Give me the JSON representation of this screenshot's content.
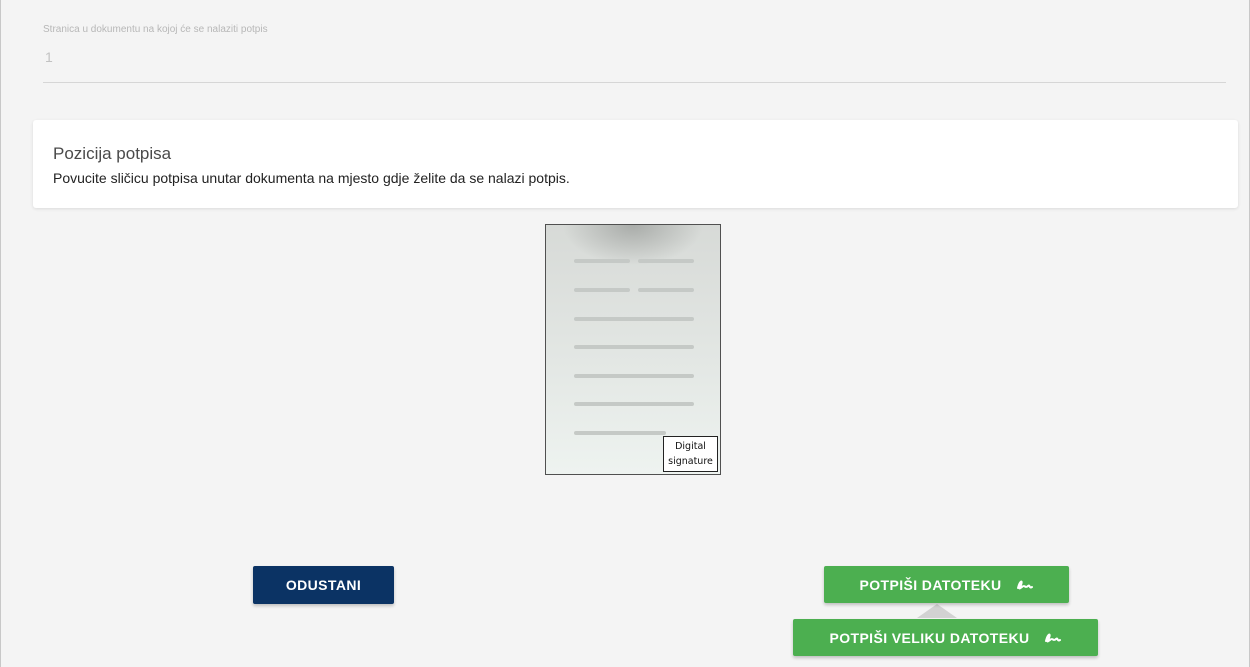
{
  "page_field": {
    "label": "Stranica u dokumentu na kojoj će se nalaziti potpis",
    "value": "1"
  },
  "position_card": {
    "title": "Pozicija potpisa",
    "instruction": "Povucite sličicu potpisa unutar dokumenta na mjesto gdje želite da se nalazi potpis."
  },
  "document_preview": {
    "signature_label_line1": "Digital",
    "signature_label_line2": "signature"
  },
  "buttons": {
    "cancel": "ODUSTANI",
    "sign_file": "POTPIŠI DATOTEKU",
    "sign_large_file": "POTPIŠI VELIKU DATOTEKU",
    "sign_icon": "signature-scribble-icon"
  },
  "colors": {
    "cancel_bg": "#0b3364",
    "sign_bg": "#4caf50",
    "page_bg": "#f4f4f4"
  }
}
